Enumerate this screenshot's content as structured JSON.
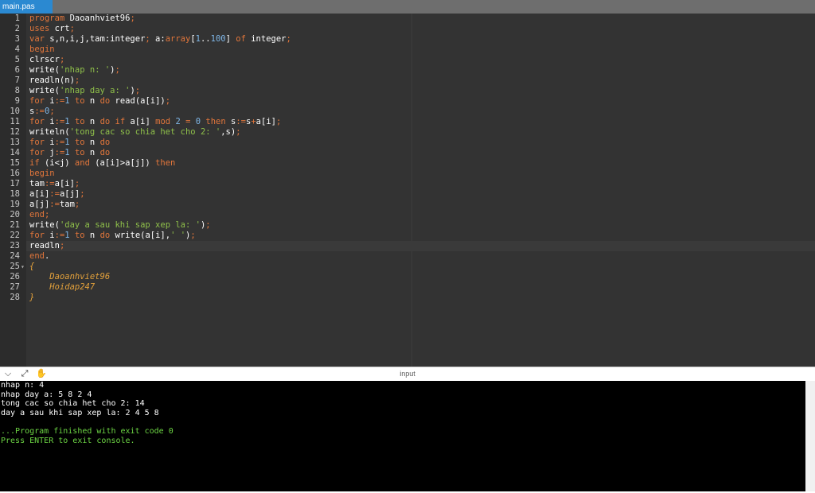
{
  "tab": {
    "label": "main.pas"
  },
  "editor": {
    "lines": [
      {
        "n": "1",
        "parts": [
          [
            "kw",
            "program"
          ],
          [
            "t",
            " Daoanhviet96"
          ],
          [
            "op",
            ";"
          ]
        ]
      },
      {
        "n": "2",
        "parts": [
          [
            "kw",
            "uses"
          ],
          [
            "t",
            " crt"
          ],
          [
            "op",
            ";"
          ]
        ]
      },
      {
        "n": "3",
        "parts": [
          [
            "kw",
            "var"
          ],
          [
            "t",
            " s,n,i,j,tam:integer"
          ],
          [
            "op",
            ";"
          ],
          [
            "t",
            " a:"
          ],
          [
            "kw",
            "array"
          ],
          [
            "t",
            "["
          ],
          [
            "num",
            "1"
          ],
          [
            "t",
            ".."
          ],
          [
            "num",
            "100"
          ],
          [
            "t",
            "] "
          ],
          [
            "kw",
            "of"
          ],
          [
            "t",
            " integer"
          ],
          [
            "op",
            ";"
          ]
        ]
      },
      {
        "n": "4",
        "parts": [
          [
            "kw",
            "begin"
          ]
        ]
      },
      {
        "n": "5",
        "parts": [
          [
            "t",
            "clrscr"
          ],
          [
            "op",
            ";"
          ]
        ]
      },
      {
        "n": "6",
        "parts": [
          [
            "t",
            "write("
          ],
          [
            "str",
            "'nhap n: '"
          ],
          [
            "t",
            ")"
          ],
          [
            "op",
            ";"
          ]
        ]
      },
      {
        "n": "7",
        "parts": [
          [
            "t",
            "readln(n)"
          ],
          [
            "op",
            ";"
          ]
        ]
      },
      {
        "n": "8",
        "parts": [
          [
            "t",
            "write("
          ],
          [
            "str",
            "'nhap day a: '"
          ],
          [
            "t",
            ")"
          ],
          [
            "op",
            ";"
          ]
        ]
      },
      {
        "n": "9",
        "parts": [
          [
            "kw",
            "for"
          ],
          [
            "t",
            " i"
          ],
          [
            "op",
            ":="
          ],
          [
            "num",
            "1"
          ],
          [
            "t",
            " "
          ],
          [
            "kw",
            "to"
          ],
          [
            "t",
            " n "
          ],
          [
            "kw",
            "do"
          ],
          [
            "t",
            " read(a[i])"
          ],
          [
            "op",
            ";"
          ]
        ]
      },
      {
        "n": "10",
        "parts": [
          [
            "t",
            "s"
          ],
          [
            "op",
            ":="
          ],
          [
            "num",
            "0"
          ],
          [
            "op",
            ";"
          ]
        ]
      },
      {
        "n": "11",
        "parts": [
          [
            "kw",
            "for"
          ],
          [
            "t",
            " i"
          ],
          [
            "op",
            ":="
          ],
          [
            "num",
            "1"
          ],
          [
            "t",
            " "
          ],
          [
            "kw",
            "to"
          ],
          [
            "t",
            " n "
          ],
          [
            "kw",
            "do"
          ],
          [
            "t",
            " "
          ],
          [
            "kw",
            "if"
          ],
          [
            "t",
            " a[i] "
          ],
          [
            "kw",
            "mod"
          ],
          [
            "t",
            " "
          ],
          [
            "num",
            "2"
          ],
          [
            "t",
            " "
          ],
          [
            "op",
            "="
          ],
          [
            "t",
            " "
          ],
          [
            "num",
            "0"
          ],
          [
            "t",
            " "
          ],
          [
            "kw",
            "then"
          ],
          [
            "t",
            " s"
          ],
          [
            "op",
            ":="
          ],
          [
            "t",
            "s"
          ],
          [
            "op",
            "+"
          ],
          [
            "t",
            "a[i]"
          ],
          [
            "op",
            ";"
          ]
        ]
      },
      {
        "n": "12",
        "parts": [
          [
            "t",
            "writeln("
          ],
          [
            "str",
            "'tong cac so chia het cho 2: '"
          ],
          [
            "t",
            ",s)"
          ],
          [
            "op",
            ";"
          ]
        ]
      },
      {
        "n": "13",
        "parts": [
          [
            "kw",
            "for"
          ],
          [
            "t",
            " i"
          ],
          [
            "op",
            ":="
          ],
          [
            "num",
            "1"
          ],
          [
            "t",
            " "
          ],
          [
            "kw",
            "to"
          ],
          [
            "t",
            " n "
          ],
          [
            "kw",
            "do"
          ]
        ]
      },
      {
        "n": "14",
        "parts": [
          [
            "kw",
            "for"
          ],
          [
            "t",
            " j"
          ],
          [
            "op",
            ":="
          ],
          [
            "num",
            "1"
          ],
          [
            "t",
            " "
          ],
          [
            "kw",
            "to"
          ],
          [
            "t",
            " n "
          ],
          [
            "kw",
            "do"
          ]
        ]
      },
      {
        "n": "15",
        "parts": [
          [
            "kw",
            "if"
          ],
          [
            "t",
            " (i<j) "
          ],
          [
            "kw",
            "and"
          ],
          [
            "t",
            " (a[i]>a[j]) "
          ],
          [
            "kw",
            "then"
          ]
        ]
      },
      {
        "n": "16",
        "parts": [
          [
            "kw",
            "begin"
          ]
        ]
      },
      {
        "n": "17",
        "parts": [
          [
            "t",
            "tam"
          ],
          [
            "op",
            ":="
          ],
          [
            "t",
            "a[i]"
          ],
          [
            "op",
            ";"
          ]
        ]
      },
      {
        "n": "18",
        "parts": [
          [
            "t",
            "a[i]"
          ],
          [
            "op",
            ":="
          ],
          [
            "t",
            "a[j]"
          ],
          [
            "op",
            ";"
          ]
        ]
      },
      {
        "n": "19",
        "parts": [
          [
            "t",
            "a[j]"
          ],
          [
            "op",
            ":="
          ],
          [
            "t",
            "tam"
          ],
          [
            "op",
            ";"
          ]
        ]
      },
      {
        "n": "20",
        "parts": [
          [
            "kw",
            "end"
          ],
          [
            "op",
            ";"
          ]
        ]
      },
      {
        "n": "21",
        "parts": [
          [
            "t",
            "write("
          ],
          [
            "str",
            "'day a sau khi sap xep la: '"
          ],
          [
            "t",
            ")"
          ],
          [
            "op",
            ";"
          ]
        ]
      },
      {
        "n": "22",
        "parts": [
          [
            "kw",
            "for"
          ],
          [
            "t",
            " i"
          ],
          [
            "op",
            ":="
          ],
          [
            "num",
            "1"
          ],
          [
            "t",
            " "
          ],
          [
            "kw",
            "to"
          ],
          [
            "t",
            " n "
          ],
          [
            "kw",
            "do"
          ],
          [
            "t",
            " write(a[i],"
          ],
          [
            "str",
            "' '"
          ],
          [
            "t",
            ")"
          ],
          [
            "op",
            ";"
          ]
        ]
      },
      {
        "n": "23",
        "parts": [
          [
            "t",
            "readln"
          ],
          [
            "op",
            ";"
          ]
        ]
      },
      {
        "n": "24",
        "parts": [
          [
            "kw",
            "end"
          ],
          [
            "t",
            "."
          ]
        ]
      },
      {
        "n": "25",
        "fold": "▾",
        "parts": [
          [
            "cmt",
            "{"
          ]
        ]
      },
      {
        "n": "26",
        "parts": [
          [
            "cmt",
            "    Daoanhviet96"
          ]
        ]
      },
      {
        "n": "27",
        "parts": [
          [
            "cmt",
            "    Hoidap247"
          ]
        ]
      },
      {
        "n": "28",
        "parts": [
          [
            "cmt",
            "}"
          ]
        ]
      }
    ]
  },
  "console_header": {
    "title": "input",
    "icons": [
      "chevron-down-icon",
      "expand-icon",
      "stdin-icon"
    ]
  },
  "console": {
    "lines": [
      {
        "text": "nhap n: 4",
        "style": "white"
      },
      {
        "text": "nhap day a: 5 8 2 4",
        "style": "white"
      },
      {
        "text": "tong cac so chia het cho 2: 14",
        "style": "white"
      },
      {
        "text": "day a sau khi sap xep la: 2 4 5 8",
        "style": "white"
      },
      {
        "text": "",
        "style": "white"
      },
      {
        "text": "...Program finished with exit code 0",
        "style": "green"
      },
      {
        "text": "Press ENTER to exit console.",
        "style": "green"
      }
    ]
  }
}
